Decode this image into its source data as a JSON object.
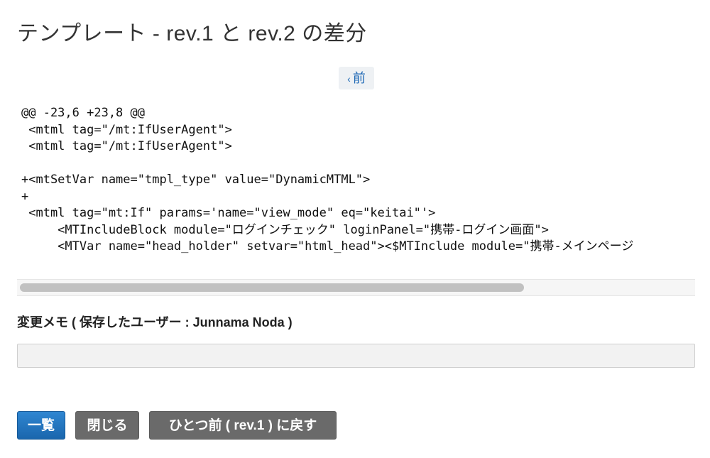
{
  "page": {
    "title": "テンプレート - rev.1 と rev.2 の差分"
  },
  "nav": {
    "prev_chevron": "‹",
    "prev_label": "前"
  },
  "diff": {
    "lines": [
      "@@ -23,6 +23,8 @@",
      " <mtml tag=\"/mt:IfUserAgent\">",
      " <mtml tag=\"/mt:IfUserAgent\">",
      "",
      "+<mtSetVar name=\"tmpl_type\" value=\"DynamicMTML\">",
      "+",
      " <mtml tag=\"mt:If\" params='name=\"view_mode\" eq=\"keitai\"'>",
      "     <MTIncludeBlock module=\"ログインチェック\" loginPanel=\"携帯-ログイン画面\">",
      "     <MTVar name=\"head_holder\" setvar=\"html_head\"><$MTInclude module=\"携帯-メインページ"
    ]
  },
  "memo": {
    "label": "変更メモ ( 保存したユーザー : Junnama Noda )",
    "value": ""
  },
  "buttons": {
    "list": "一覧",
    "close": "閉じる",
    "revert": "ひとつ前 ( rev.1 ) に戻す"
  },
  "colors": {
    "primary": "#1a66ad",
    "gray_button": "#6a6a6a",
    "link": "#1d68b5"
  }
}
